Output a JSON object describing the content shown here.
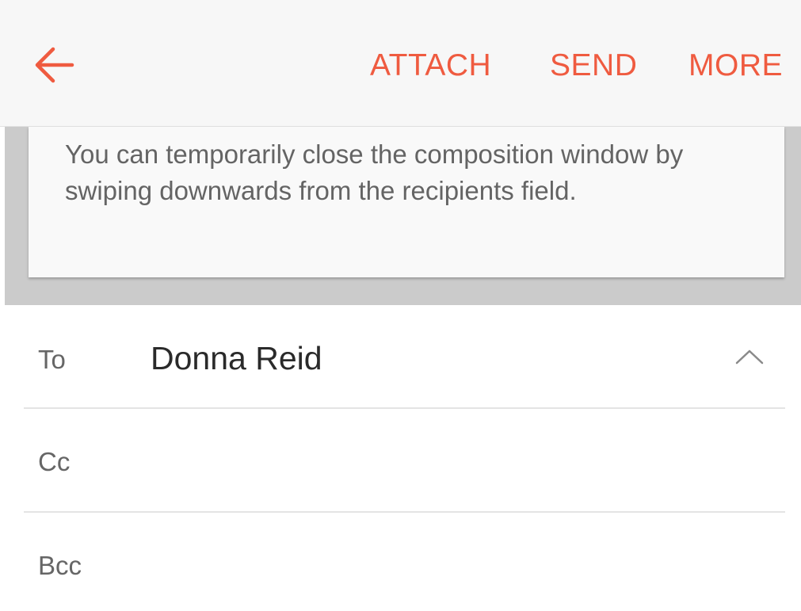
{
  "app_bar": {
    "back_icon": "arrow-left-icon",
    "actions": {
      "attach": "ATTACH",
      "send": "SEND",
      "more": "MORE"
    }
  },
  "hint": {
    "text": "You can temporarily close the composition window by swiping downwards from the recipients field."
  },
  "fields": {
    "to": {
      "label": "To",
      "value": "Donna Reid",
      "expand_icon": "chevron-up-icon"
    },
    "cc": {
      "label": "Cc",
      "value": ""
    },
    "bcc": {
      "label": "Bcc",
      "value": ""
    }
  },
  "colors": {
    "accent": "#ef5b40",
    "app_bar_bg": "#f7f7f7",
    "hint_band_bg": "#cbcbcb",
    "hint_text": "#646464",
    "divider": "#e4e4e4"
  }
}
